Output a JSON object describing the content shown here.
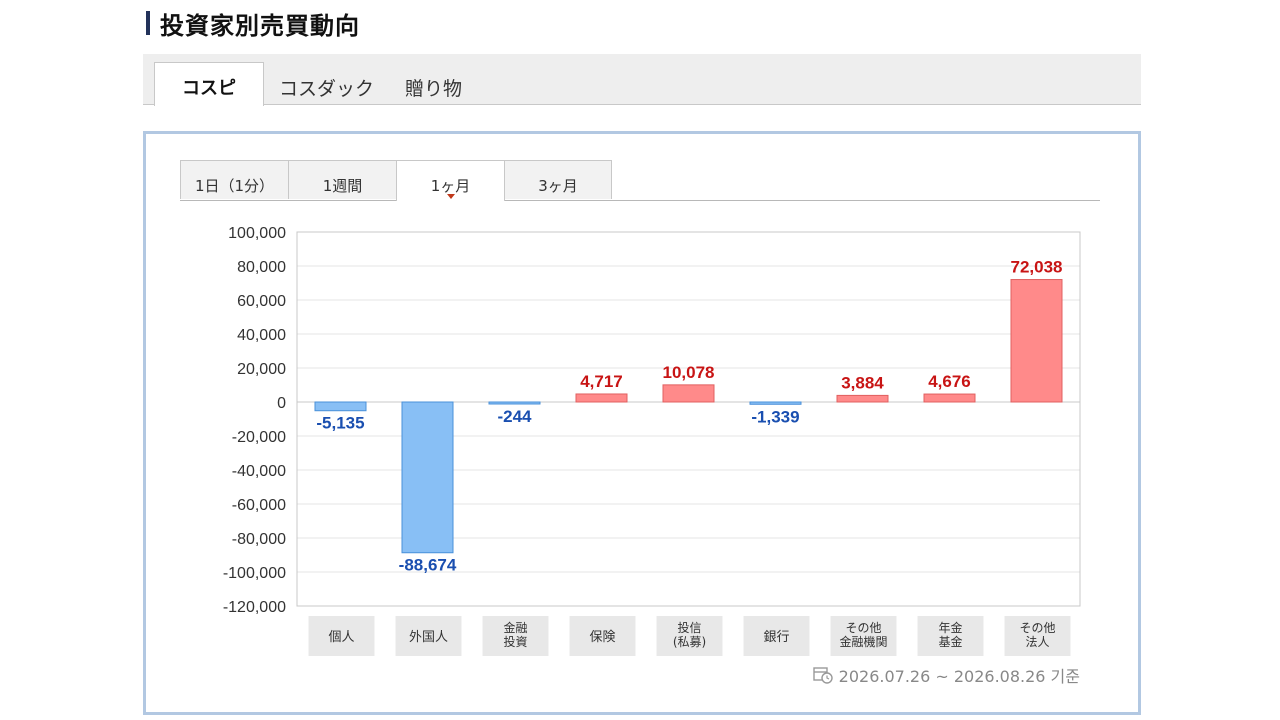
{
  "page_title": "投資家別売買動向",
  "market_tabs": [
    {
      "label": "コスピ",
      "active": true
    },
    {
      "label": "コスダック",
      "active": false
    },
    {
      "label": "贈り物",
      "active": false
    }
  ],
  "period_tabs": [
    {
      "label": "1日（1分）",
      "active": false
    },
    {
      "label": "1週間",
      "active": false
    },
    {
      "label": "1ヶ月",
      "active": true
    },
    {
      "label": "3ヶ月",
      "active": false
    }
  ],
  "colors": {
    "positive_fill": "#ff8a8a",
    "positive_stroke": "#e06060",
    "positive_label": "#c81414",
    "negative_fill": "#88bff5",
    "negative_stroke": "#4a90d9",
    "negative_label": "#1a4fb0"
  },
  "date_range": "2026.07.26 ~ 2026.08.26 기준",
  "icon": "calendar-clock-icon",
  "chart_data": {
    "type": "bar",
    "categories": [
      "個人",
      "外国人",
      "金融\n投資",
      "保険",
      "投信\n(私募)",
      "銀行",
      "その他\n金融機関",
      "年金\n基金",
      "その他\n法人"
    ],
    "values": [
      -5135,
      -88674,
      -244,
      4717,
      10078,
      -1339,
      3884,
      4676,
      72038
    ],
    "data_labels": [
      "-5,135",
      "-88,674",
      "-244",
      "4,717",
      "10,078",
      "-1,339",
      "3,884",
      "4,676",
      "72,038"
    ],
    "yticks": [
      "100,000",
      "80,000",
      "60,000",
      "40,000",
      "20,000",
      "0",
      "-20,000",
      "-40,000",
      "-60,000",
      "-80,000",
      "-100,000",
      "-120,000"
    ],
    "ylim": [
      -120000,
      100000
    ],
    "grid": true,
    "title": "",
    "xlabel": "",
    "ylabel": ""
  }
}
